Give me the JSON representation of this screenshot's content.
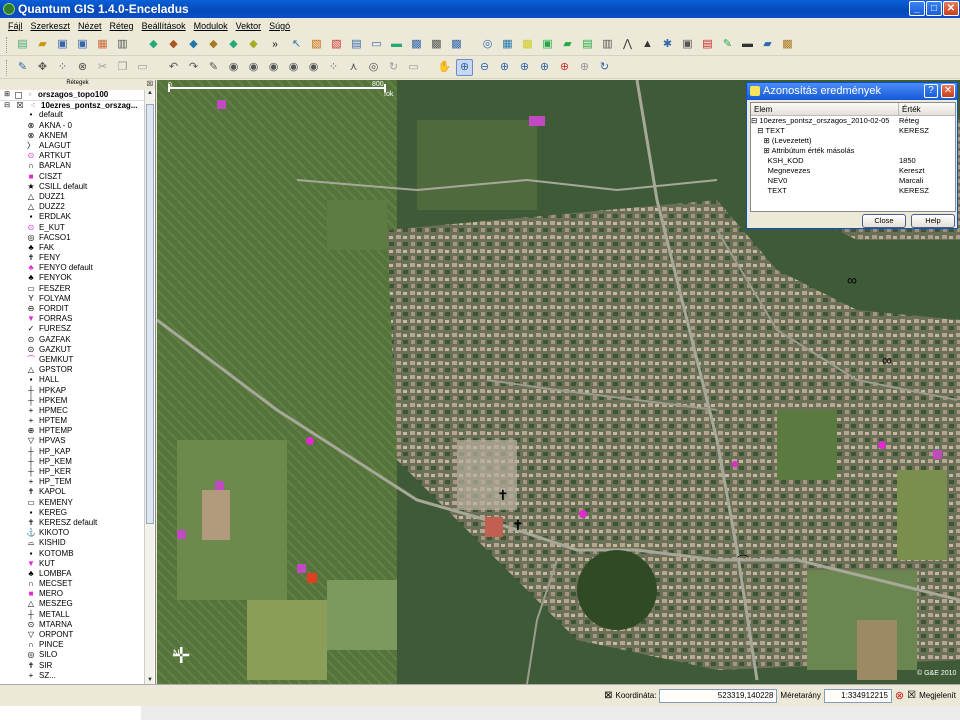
{
  "window": {
    "title": "Quantum GIS 1.4.0-Enceladus",
    "minimize": "_",
    "restore": "□",
    "close": "✕"
  },
  "menu": [
    "Fájl",
    "Szerkeszt",
    "Nézet",
    "Réteg",
    "Beállítások",
    "Modulok",
    "Vektor",
    "Súgó"
  ],
  "layers_panel": {
    "header": "Rétegek",
    "top_layer": "orszagos_topo100",
    "active_layer": "10ezres_pontsz_orszag...",
    "items": [
      {
        "label": "default",
        "icon": "dot"
      },
      {
        "label": "AKNA - 0",
        "icon": "circle-x"
      },
      {
        "label": "AKNEM",
        "icon": "circle-x"
      },
      {
        "label": "ALAGUT",
        "icon": "chevron"
      },
      {
        "label": "ARTKUT",
        "icon": "circle-dot-pink"
      },
      {
        "label": "BARLAN",
        "icon": "arch"
      },
      {
        "label": "CISZT",
        "icon": "square-pink"
      },
      {
        "label": "CSILL default",
        "icon": "star"
      },
      {
        "label": "DUZZ1",
        "icon": "triangle"
      },
      {
        "label": "DUZZ2",
        "icon": "triangle"
      },
      {
        "label": "ERDLAK",
        "icon": "square-small"
      },
      {
        "label": "E_KUT",
        "icon": "circle-pink"
      },
      {
        "label": "FACSO1",
        "icon": "circle-ring"
      },
      {
        "label": "FAK",
        "icon": "tree"
      },
      {
        "label": "FENY",
        "icon": "cross"
      },
      {
        "label": "FENYO default",
        "icon": "tree-pink"
      },
      {
        "label": "FENYOK",
        "icon": "tree"
      },
      {
        "label": "FESZER",
        "icon": "box"
      },
      {
        "label": "FOLYAM",
        "icon": "y"
      },
      {
        "label": "FORDIT",
        "icon": "circle-line"
      },
      {
        "label": "FORRAS",
        "icon": "pin-pink"
      },
      {
        "label": "FURESZ",
        "icon": "saw"
      },
      {
        "label": "GAZFAK",
        "icon": "circle-dot"
      },
      {
        "label": "GAZKUT",
        "icon": "circle-dot"
      },
      {
        "label": "GEMKUT",
        "icon": "arc-pink"
      },
      {
        "label": "GPSTOR",
        "icon": "triangle"
      },
      {
        "label": "HALL",
        "icon": "square-small"
      },
      {
        "label": "HPKAP",
        "icon": "t-cross"
      },
      {
        "label": "HPKEM",
        "icon": "t-cross"
      },
      {
        "label": "HPMEC",
        "icon": "plus"
      },
      {
        "label": "HPTEM",
        "icon": "plus"
      },
      {
        "label": "HPTEMP",
        "icon": "circle-plus"
      },
      {
        "label": "HPVAS",
        "icon": "triangle-down"
      },
      {
        "label": "HP_KAP",
        "icon": "t-cross"
      },
      {
        "label": "HP_KEM",
        "icon": "t-cross"
      },
      {
        "label": "HP_KER",
        "icon": "t-cross"
      },
      {
        "label": "HP_TEM",
        "icon": "plus"
      },
      {
        "label": "KAPOL",
        "icon": "cross"
      },
      {
        "label": "KEMENY",
        "icon": "box"
      },
      {
        "label": "KEREG",
        "icon": "square-small"
      },
      {
        "label": "KERESZ default",
        "icon": "cross"
      },
      {
        "label": "KIKOTO",
        "icon": "anchor"
      },
      {
        "label": "KISHID",
        "icon": "bridge"
      },
      {
        "label": "KOTOMB",
        "icon": "square-small"
      },
      {
        "label": "KUT",
        "icon": "pin-pink"
      },
      {
        "label": "LOMBFA",
        "icon": "tree"
      },
      {
        "label": "MECSET",
        "icon": "arch"
      },
      {
        "label": "MERO",
        "icon": "square-pink"
      },
      {
        "label": "MESZEG",
        "icon": "triangle"
      },
      {
        "label": "METALL",
        "icon": "t-cross"
      },
      {
        "label": "MTARNA",
        "icon": "circle-dot"
      },
      {
        "label": "ORPONT",
        "icon": "triangle-down"
      },
      {
        "label": "PINCE",
        "icon": "arch"
      },
      {
        "label": "SILO",
        "icon": "circle-ring"
      },
      {
        "label": "SIR",
        "icon": "cross"
      },
      {
        "label": "SZ...",
        "icon": "plus"
      }
    ]
  },
  "map": {
    "scale_start": "0",
    "scale_end": "800",
    "scale_unit": "fok",
    "copyright": "© G&E 2010"
  },
  "identify": {
    "title": "Azonosítás eredmények",
    "help_q": "?",
    "close_x": "✕",
    "col_element": "Elem",
    "col_value": "Érték",
    "rows": [
      {
        "k": "⊟ 10ezres_pontsz_orszagos_2010-02-05",
        "v": "Réteg"
      },
      {
        "k": "   ⊟ TEXT",
        "v": "KERESZ"
      },
      {
        "k": "      ⊞ (Levezetett)",
        "v": ""
      },
      {
        "k": "      ⊞ Attribútum érték másolás",
        "v": ""
      },
      {
        "k": "        KSH_KOD",
        "v": "1850"
      },
      {
        "k": "        Megnevezes",
        "v": "Kereszt"
      },
      {
        "k": "        NEV0",
        "v": "Marcali"
      },
      {
        "k": "        TEXT",
        "v": "KERESZ"
      }
    ],
    "close_button": "Close",
    "help_button": "Help"
  },
  "status": {
    "coord_label": "Koordináta:",
    "coord_value": "523319,140228",
    "scale_label": "Méretarány",
    "scale_value": "1:334912215",
    "render_label": "Megjelenít"
  }
}
